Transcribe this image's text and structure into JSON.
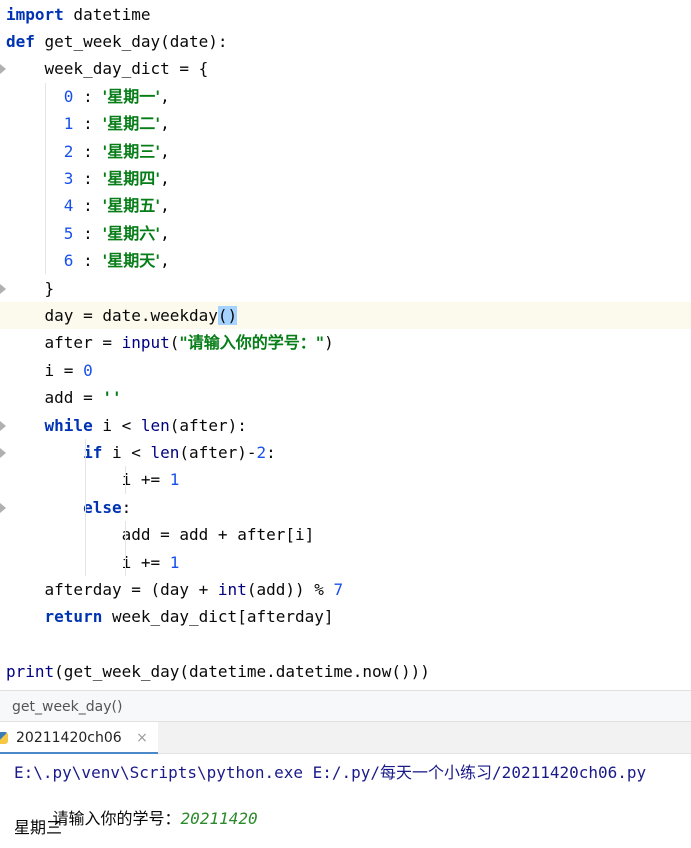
{
  "editor": {
    "lines": [
      [
        [
          "kw",
          "import"
        ],
        [
          "p",
          " datetime"
        ]
      ],
      [
        [
          "kw",
          "def"
        ],
        [
          "p",
          " get_week_day(date):"
        ]
      ],
      [
        [
          "p",
          "    week_day_dict = {"
        ]
      ],
      [
        [
          "p",
          "      "
        ],
        [
          "num",
          "0"
        ],
        [
          "p",
          " : "
        ],
        [
          "str",
          "'星期一'"
        ],
        [
          "p",
          ","
        ]
      ],
      [
        [
          "p",
          "      "
        ],
        [
          "num",
          "1"
        ],
        [
          "p",
          " : "
        ],
        [
          "str",
          "'星期二'"
        ],
        [
          "p",
          ","
        ]
      ],
      [
        [
          "p",
          "      "
        ],
        [
          "num",
          "2"
        ],
        [
          "p",
          " : "
        ],
        [
          "str",
          "'星期三'"
        ],
        [
          "p",
          ","
        ]
      ],
      [
        [
          "p",
          "      "
        ],
        [
          "num",
          "3"
        ],
        [
          "p",
          " : "
        ],
        [
          "str",
          "'星期四'"
        ],
        [
          "p",
          ","
        ]
      ],
      [
        [
          "p",
          "      "
        ],
        [
          "num",
          "4"
        ],
        [
          "p",
          " : "
        ],
        [
          "str",
          "'星期五'"
        ],
        [
          "p",
          ","
        ]
      ],
      [
        [
          "p",
          "      "
        ],
        [
          "num",
          "5"
        ],
        [
          "p",
          " : "
        ],
        [
          "str",
          "'星期六'"
        ],
        [
          "p",
          ","
        ]
      ],
      [
        [
          "p",
          "      "
        ],
        [
          "num",
          "6"
        ],
        [
          "p",
          " : "
        ],
        [
          "str",
          "'星期天'"
        ],
        [
          "p",
          ","
        ]
      ],
      [
        [
          "p",
          "    }"
        ]
      ],
      [
        [
          "p",
          "    day = date.weekday"
        ],
        [
          "hl",
          "()"
        ]
      ],
      [
        [
          "p",
          "    after = "
        ],
        [
          "bi",
          "input"
        ],
        [
          "p",
          "("
        ],
        [
          "str",
          "\"请输入你的学号：\""
        ],
        [
          "p",
          ")"
        ]
      ],
      [
        [
          "p",
          "    i = "
        ],
        [
          "num",
          "0"
        ]
      ],
      [
        [
          "p",
          "    add = "
        ],
        [
          "str",
          "''"
        ]
      ],
      [
        [
          "p",
          "    "
        ],
        [
          "kw",
          "while"
        ],
        [
          "p",
          " i < "
        ],
        [
          "bi",
          "len"
        ],
        [
          "p",
          "(after):"
        ]
      ],
      [
        [
          "p",
          "        "
        ],
        [
          "kw",
          "if"
        ],
        [
          "p",
          " i < "
        ],
        [
          "bi",
          "len"
        ],
        [
          "p",
          "(after)-"
        ],
        [
          "num",
          "2"
        ],
        [
          "p",
          ":"
        ]
      ],
      [
        [
          "p",
          "            i += "
        ],
        [
          "num",
          "1"
        ]
      ],
      [
        [
          "p",
          "        "
        ],
        [
          "kw",
          "else"
        ],
        [
          "p",
          ":"
        ]
      ],
      [
        [
          "p",
          "            add = add + after[i]"
        ]
      ],
      [
        [
          "p",
          "            i += "
        ],
        [
          "num",
          "1"
        ]
      ],
      [
        [
          "p",
          "    afterday = (day + "
        ],
        [
          "bi",
          "int"
        ],
        [
          "p",
          "(add)) % "
        ],
        [
          "num",
          "7"
        ]
      ],
      [
        [
          "p",
          "    "
        ],
        [
          "kw",
          "return"
        ],
        [
          "p",
          " week_day_dict[afterday]"
        ]
      ],
      [
        [
          "p",
          ""
        ]
      ],
      [
        [
          "bi",
          "print"
        ],
        [
          "p",
          "(get_week_day(datetime.datetime.now()))"
        ]
      ]
    ],
    "current_line": 11
  },
  "breadcrumb": {
    "label": "get_week_day()"
  },
  "run": {
    "tab_label": "20211420ch06",
    "close_glyph": "×",
    "command": "E:\\.py\\venv\\Scripts\\python.exe E:/.py/每天一个小练习/20211420ch06.py",
    "prompt": "请输入你的学号：",
    "input_value": "20211420",
    "output": "星期三"
  },
  "colors": {
    "keyword": "#0033b3",
    "number": "#1750eb",
    "string": "#067d17",
    "builtin": "#000080",
    "current_line_bg": "#fcfaed",
    "tab_underline": "#4a88c7"
  }
}
